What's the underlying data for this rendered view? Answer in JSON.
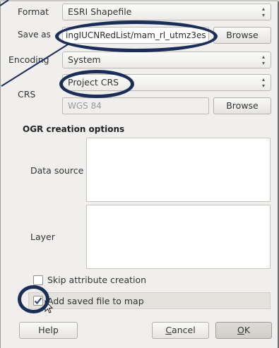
{
  "form": {
    "format": {
      "label": "Format",
      "value": "ESRI Shapefile"
    },
    "save_as": {
      "label": "Save as",
      "value": "ingIUCNRedList/mam_rl_utmz3es",
      "browse_label": "Browse"
    },
    "encoding": {
      "label": "Encoding",
      "value": "System"
    },
    "crs": {
      "label": "CRS",
      "value": "Project CRS",
      "selected_crs": "WGS 84",
      "browse_label": "Browse"
    }
  },
  "ogr_options": {
    "title": "OGR creation options",
    "data_source_label": "Data source",
    "layer_label": "Layer"
  },
  "options": {
    "skip_attribute": {
      "label": "Skip attribute creation",
      "checked": false
    },
    "add_to_map": {
      "label": "Add saved file to map",
      "checked": true
    }
  },
  "buttons": {
    "help": "Help",
    "cancel_rest": "ancel",
    "cancel_mnemonic": "C",
    "ok_mnemonic": "O",
    "ok_rest": "K"
  },
  "colors": {
    "annotation": "#1a2e58",
    "window_bg": "#f0efed",
    "check_mark": "#2a4a7a"
  }
}
